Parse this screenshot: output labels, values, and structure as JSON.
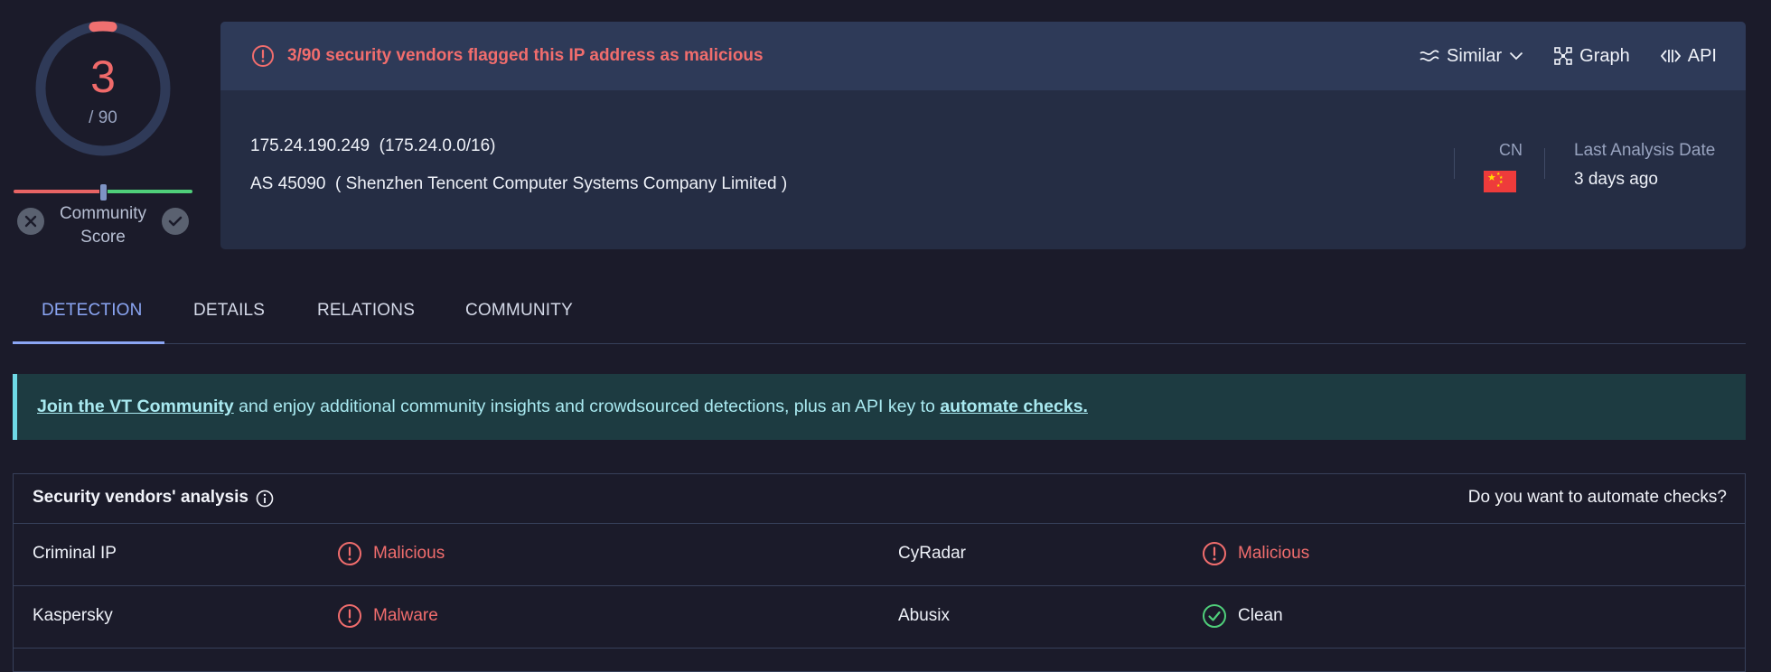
{
  "score": {
    "value": "3",
    "total": "/ 90",
    "community_label": "Community\nScore"
  },
  "header": {
    "alert": "3/90 security vendors flagged this IP address as malicious",
    "actions": {
      "similar": "Similar",
      "graph": "Graph",
      "api": "API"
    },
    "ip": "175.24.190.249  (175.24.0.0/16)",
    "as": "AS 45090  ( Shenzhen Tencent Computer Systems Company Limited )",
    "country_code": "CN",
    "last_analysis_label": "Last Analysis Date",
    "last_analysis_value": "3 days ago"
  },
  "tabs": [
    {
      "label": "DETECTION"
    },
    {
      "label": "DETAILS"
    },
    {
      "label": "RELATIONS"
    },
    {
      "label": "COMMUNITY"
    }
  ],
  "banner": {
    "link1": "Join the VT Community",
    "text": " and enjoy additional community insights and crowdsourced detections, plus an API key to ",
    "link2": "automate checks."
  },
  "vendors": {
    "title": "Security vendors' analysis",
    "automate": "Do you want to automate checks?",
    "rows": [
      {
        "left_vendor": "Criminal IP",
        "left_verdict": "Malicious",
        "right_vendor": "CyRadar",
        "right_verdict": "Malicious"
      },
      {
        "left_vendor": "Kaspersky",
        "left_verdict": "Malware",
        "right_vendor": "Abusix",
        "right_verdict": "Clean"
      }
    ]
  },
  "colors": {
    "malicious": "#f16d6d",
    "clean": "#4fcf7a",
    "accent": "#8ba6f4",
    "banner_bg": "#1d3b41"
  },
  "icons": [
    "alert-circle-icon",
    "similar-icon",
    "chevron-down-icon",
    "graph-icon",
    "api-icon",
    "close-icon",
    "check-icon",
    "info-icon",
    "cn-flag-icon"
  ]
}
